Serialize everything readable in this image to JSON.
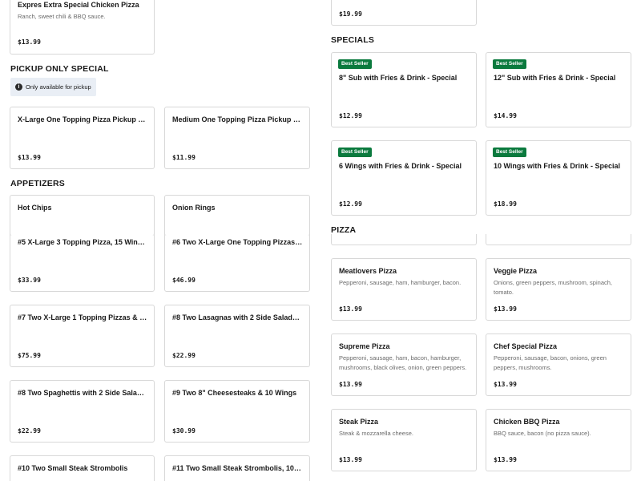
{
  "left": {
    "top_item": {
      "name": "Expres Extra Special Chicken Pizza",
      "desc": "Ranch, sweet chili & BBQ sauce.",
      "price": "$13.99"
    },
    "pickup_section": {
      "title": "PICKUP ONLY SPECIAL",
      "notice": "Only available for pickup",
      "items": [
        {
          "name": "X-Large One Topping Pizza Pickup Only...",
          "price": "$13.99"
        },
        {
          "name": "Medium One Topping Pizza Pickup Only...",
          "price": "$11.99"
        }
      ]
    },
    "appetizers_section": {
      "title": "APPETIZERS",
      "items": [
        {
          "name": "Hot Chips"
        },
        {
          "name": "Onion Rings"
        },
        {
          "name": "#5 X-Large 3 Topping Pizza, 15 Wings & 1...",
          "price": "$33.99"
        },
        {
          "name": "#6 Two X-Large One Topping Pizzas, 20...",
          "price": "$46.99"
        },
        {
          "name": "#7 Two X-Large 1 Topping Pizzas & 50...",
          "price": "$75.99"
        },
        {
          "name": "#8 Two Lasagnas with 2 Side Salads & 2...",
          "price": "$22.99"
        },
        {
          "name": "#8 Two Spaghettis with 2 Side Salads & ...",
          "price": "$22.99"
        },
        {
          "name": "#9 Two 8\" Cheesesteaks & 10 Wings",
          "price": "$30.99"
        },
        {
          "name": "#10 Two Small Steak Strombolis"
        },
        {
          "name": "#11 Two Small Steak Strombolis, 10 Wing..."
        }
      ]
    }
  },
  "right": {
    "top_item": {
      "price": "$19.99"
    },
    "specials_section": {
      "title": "SPECIALS",
      "items": [
        {
          "badge": "Best Seller",
          "name": "8\" Sub with Fries & Drink - Special",
          "price": "$12.99"
        },
        {
          "badge": "Best Seller",
          "name": "12\" Sub with Fries & Drink - Special",
          "price": "$14.99"
        },
        {
          "badge": "Best Seller",
          "name": "6 Wings with Fries & Drink - Special",
          "price": "$12.99"
        },
        {
          "badge": "Best Seller",
          "name": "10 Wings with Fries & Drink - Special",
          "price": "$18.99"
        }
      ]
    },
    "pizza_section": {
      "title": "PIZZA",
      "items": [
        {
          "name": "Meatlovers Pizza",
          "desc": "Pepperoni, sausage, ham, hamburger, bacon.",
          "price": "$13.99"
        },
        {
          "name": "Veggie Pizza",
          "desc": "Onions, green peppers, mushroom, spinach, tomato.",
          "price": "$13.99"
        },
        {
          "name": "Supreme Pizza",
          "desc": "Pepperoni, sausage, ham, bacon, hamburger, mushrooms, black olives, onion, green peppers.",
          "price": "$13.99"
        },
        {
          "name": "Chef Special Pizza",
          "desc": "Pepperoni, sausage, bacon, onions, green peppers, mushrooms.",
          "price": "$13.99"
        },
        {
          "name": "Steak Pizza",
          "desc": "Steak & mozzarella cheese.",
          "price": "$13.99"
        },
        {
          "name": "Chicken BBQ Pizza",
          "desc": "BBQ sauce, bacon (no pizza sauce).",
          "price": "$13.99"
        }
      ]
    }
  },
  "colors": {
    "badge_bg": "#0b7a3e",
    "notice_bg": "#e9eef5",
    "card_border": "#d8d8d8"
  },
  "icons": {
    "notice_icon": "info-icon"
  }
}
